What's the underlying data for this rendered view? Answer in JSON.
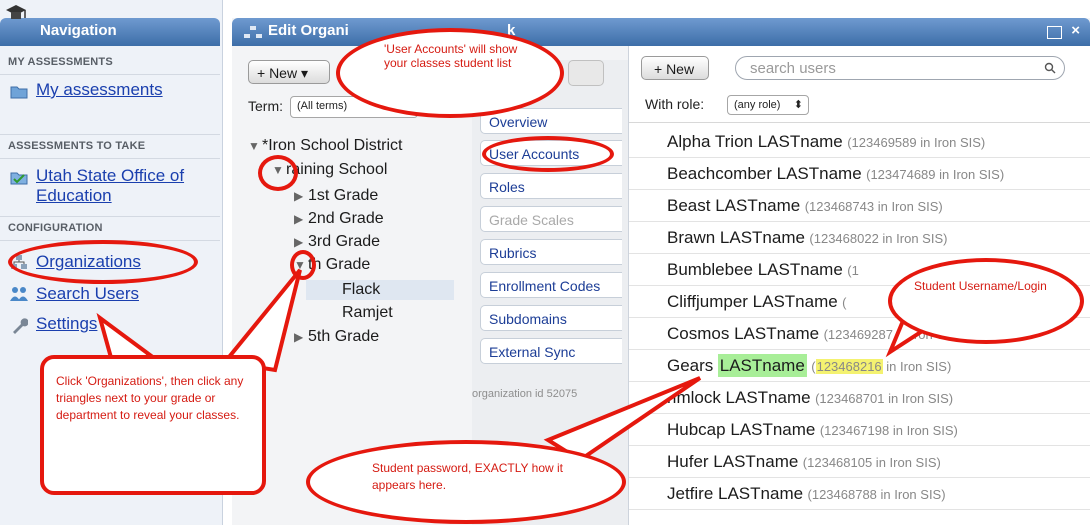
{
  "nav": {
    "title": "Navigation",
    "sections": [
      {
        "label": "MY ASSESSMENTS",
        "items": [
          "My assessments"
        ]
      },
      {
        "label": "ASSESSMENTS TO TAKE",
        "items": [
          "Utah State Office of Education"
        ]
      },
      {
        "label": "CONFIGURATION",
        "items": [
          "Organizations",
          "Search Users",
          "Settings"
        ]
      }
    ]
  },
  "org": {
    "title": "Edit Organi",
    "title_tail": "k",
    "new_button": "+ New ▾",
    "term_label": "Term:",
    "term_value": "(All terms)",
    "tree": {
      "root": "*Iron School District",
      "school": "raining School",
      "grades": [
        "1st Grade",
        "2nd Grade",
        "3rd Grade",
        "th Grade"
      ],
      "classes": [
        "Flack",
        "Ramjet"
      ],
      "last": "5th Grade"
    },
    "tabs": [
      "Overview",
      "User Accounts",
      "Roles",
      "Grade Scales",
      "Rubrics",
      "Enrollment Codes",
      "Subdomains",
      "External Sync"
    ],
    "org_id": "organization id 52075"
  },
  "users": {
    "new_button": "+ New",
    "search_placeholder": "search users",
    "role_label": "With role:",
    "role_value": "(any role)",
    "rows": [
      {
        "name": "Alpha Trion LASTname",
        "id": "(123469589 in Iron SIS)"
      },
      {
        "name": "Beachcomber LASTname",
        "id": "(123474689 in Iron SIS)"
      },
      {
        "name": "Beast LASTname",
        "id": "(123468743 in Iron SIS)"
      },
      {
        "name": "Brawn LASTname",
        "id": "(123468022 in Iron SIS)"
      },
      {
        "name": "Bumblebee LASTname",
        "id": "(1"
      },
      {
        "name": "Cliffjumper LASTname",
        "id": "("
      },
      {
        "name": "Cosmos LASTname",
        "id": "(123469287 in Iron SIS)"
      },
      {
        "name_first": "Gears",
        "name_last": "LASTname",
        "id_open": "(",
        "id_num": "123468216",
        "id_rest": " in Iron SIS)"
      },
      {
        "name": "rimlock LASTname",
        "id": "(123468701 in Iron SIS)"
      },
      {
        "name": "Hubcap LASTname",
        "id": "(123467198 in Iron SIS)"
      },
      {
        "name": "Hufer LASTname",
        "id": "(123468105 in Iron SIS)"
      },
      {
        "name": "Jetfire LASTname",
        "id": "(123468788 in Iron SIS)"
      }
    ]
  },
  "callouts": {
    "user_accounts": "'User Accounts' will show your classes student list",
    "organizations": "Click 'Organizations', then click any triangles next to your grade or department to reveal your classes.",
    "password": "Student password, EXACTLY how it appears here.",
    "username": "Student Username/Login"
  },
  "colors": {
    "annotation_red": "#e5180e",
    "header_blue": "#4f7fbb",
    "highlight_green": "#a8ee98",
    "highlight_yellow": "#f4f270"
  }
}
